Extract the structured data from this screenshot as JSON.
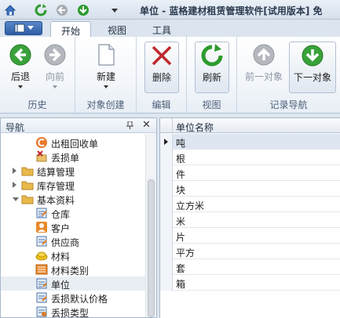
{
  "window": {
    "title": "单位 - 蓝格建材租赁管理软件[试用版本] 免"
  },
  "quick_access": [
    "home-icon",
    "refresh-icon",
    "back-icon",
    "forward-icon",
    "dropdown-icon"
  ],
  "tabs": [
    {
      "label": "开始",
      "active": true
    },
    {
      "label": "视图",
      "active": false
    },
    {
      "label": "工具",
      "active": false
    }
  ],
  "ribbon": {
    "groups": {
      "history": "历史",
      "create": "对象创建",
      "edit": "编辑",
      "view": "视图",
      "record_nav": "记录导航"
    },
    "buttons": {
      "back": "后退",
      "forward": "向前",
      "new": "新建",
      "delete": "删除",
      "refresh": "刷新",
      "prev": "前一对象",
      "next": "下一对象"
    }
  },
  "nav": {
    "title": "导航",
    "pin": "ㅁ",
    "close": "✕",
    "items": [
      {
        "label": "出租回收单",
        "level": 2,
        "icon": "rent-return-icon"
      },
      {
        "label": "丢损单",
        "level": 2,
        "icon": "loss-icon"
      },
      {
        "label": "结算管理",
        "level": 1,
        "icon": "folder-icon",
        "expander": "closed"
      },
      {
        "label": "库存管理",
        "level": 1,
        "icon": "folder-icon",
        "expander": "closed"
      },
      {
        "label": "基本资料",
        "level": 1,
        "icon": "folder-icon",
        "expander": "open"
      },
      {
        "label": "仓库",
        "level": 2,
        "icon": "warehouse-icon"
      },
      {
        "label": "客户",
        "level": 2,
        "icon": "customer-icon"
      },
      {
        "label": "供应商",
        "level": 2,
        "icon": "supplier-icon"
      },
      {
        "label": "材料",
        "level": 2,
        "icon": "material-icon"
      },
      {
        "label": "材料类别",
        "level": 2,
        "icon": "category-icon"
      },
      {
        "label": "单位",
        "level": 2,
        "icon": "unit-icon",
        "selected": true
      },
      {
        "label": "丢损默认价格",
        "level": 2,
        "icon": "price-icon"
      },
      {
        "label": "丢损类型",
        "level": 2,
        "icon": "loss-type-icon"
      }
    ]
  },
  "grid": {
    "column": "单位名称",
    "rows": [
      "吨",
      "根",
      "件",
      "块",
      "立方米",
      "米",
      "片",
      "平方",
      "套",
      "箱"
    ],
    "current_row": 0
  },
  "colors": {
    "accent": "#2d5ea6",
    "green": "#3aa23a",
    "red": "#c0282d",
    "folder": "#e8b84a"
  }
}
